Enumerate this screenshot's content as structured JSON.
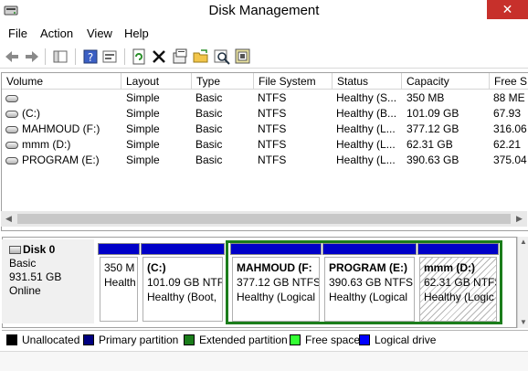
{
  "window": {
    "title": "Disk Management",
    "close_glyph": "✕"
  },
  "menu": {
    "items": [
      "File",
      "Action",
      "View",
      "Help"
    ]
  },
  "toolbar": {
    "buttons": [
      "back-arrow-icon",
      "forward-arrow-icon",
      "console-tree-icon",
      "help-icon",
      "properties-icon",
      "refresh-icon",
      "delete-icon",
      "settings-icon",
      "open-folder-icon",
      "explore-search-icon",
      "help-topics-icon"
    ]
  },
  "volume_list": {
    "columns": [
      "Volume",
      "Layout",
      "Type",
      "File System",
      "Status",
      "Capacity",
      "Free S"
    ],
    "rows": [
      {
        "volume": "",
        "layout": "Simple",
        "type": "Basic",
        "fs": "NTFS",
        "status": "Healthy (S...",
        "capacity": "350 MB",
        "free": "88 ME"
      },
      {
        "volume": "(C:)",
        "layout": "Simple",
        "type": "Basic",
        "fs": "NTFS",
        "status": "Healthy (B...",
        "capacity": "101.09 GB",
        "free": "67.93"
      },
      {
        "volume": "MAHMOUD (F:)",
        "layout": "Simple",
        "type": "Basic",
        "fs": "NTFS",
        "status": "Healthy (L...",
        "capacity": "377.12 GB",
        "free": "316.06"
      },
      {
        "volume": "mmm (D:)",
        "layout": "Simple",
        "type": "Basic",
        "fs": "NTFS",
        "status": "Healthy (L...",
        "capacity": "62.31 GB",
        "free": "62.21"
      },
      {
        "volume": "PROGRAM (E:)",
        "layout": "Simple",
        "type": "Basic",
        "fs": "NTFS",
        "status": "Healthy (L...",
        "capacity": "390.63 GB",
        "free": "375.04"
      }
    ]
  },
  "disk": {
    "name": "Disk 0",
    "type": "Basic",
    "size": "931.51 GB",
    "state": "Online",
    "partitions": [
      {
        "name": "",
        "size": "350 M",
        "status": "Health"
      },
      {
        "name": "(C:)",
        "size": "101.09 GB NTFS",
        "status": "Healthy (Boot,"
      },
      {
        "name": "MAHMOUD  (F:",
        "size": "377.12 GB NTFS",
        "status": "Healthy (Logical"
      },
      {
        "name": "PROGRAM  (E:)",
        "size": "390.63 GB NTFS",
        "status": "Healthy (Logical"
      },
      {
        "name": "mmm  (D:)",
        "size": "62.31 GB NTFS",
        "status": "Healthy (Logic"
      }
    ]
  },
  "legend": [
    {
      "label": "Unallocated",
      "color": "#000000"
    },
    {
      "label": "Primary partition",
      "color": "#000080"
    },
    {
      "label": "Extended partition",
      "color": "#1b7d1b"
    },
    {
      "label": "Free space",
      "color": "#33ff33"
    },
    {
      "label": "Logical drive",
      "color": "#0000ff"
    }
  ],
  "colors": {
    "partition_bar": "#0000c8",
    "extended_frame": "#1b7d1b",
    "close_button": "#c7302b"
  }
}
